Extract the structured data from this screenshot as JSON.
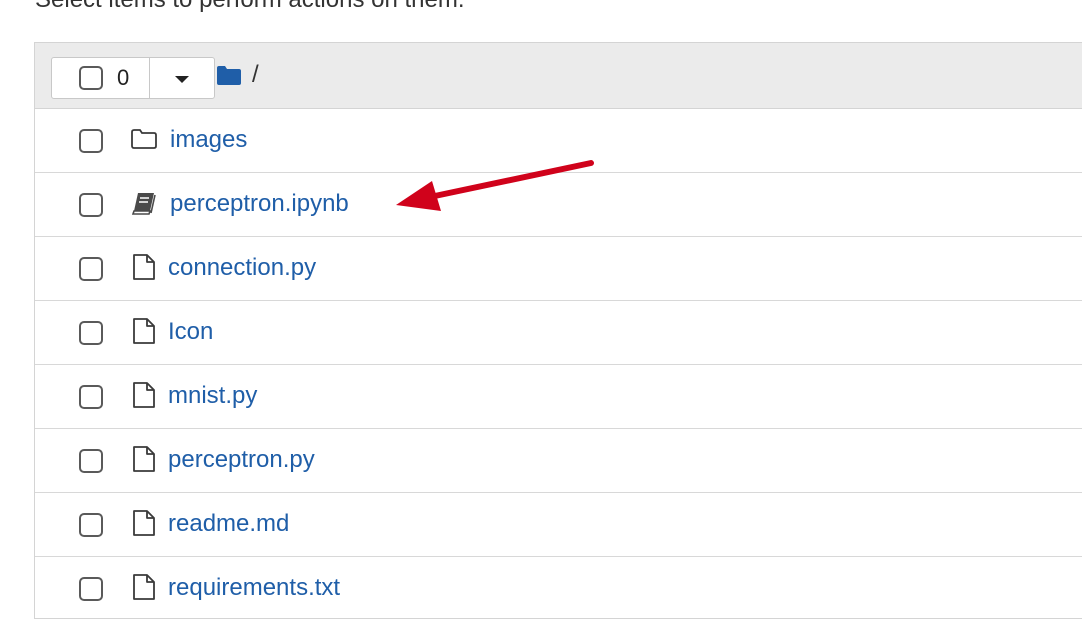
{
  "instruction": "Select items to perform actions on them.",
  "toolbar": {
    "selected_count": "0",
    "breadcrumb": "/"
  },
  "files": [
    {
      "name": "images",
      "type": "folder",
      "icon": "folder-icon"
    },
    {
      "name": "perceptron.ipynb",
      "type": "notebook",
      "icon": "notebook-icon"
    },
    {
      "name": "connection.py",
      "type": "file",
      "icon": "file-icon"
    },
    {
      "name": "Icon",
      "type": "file",
      "icon": "file-icon"
    },
    {
      "name": "mnist.py",
      "type": "file",
      "icon": "file-icon"
    },
    {
      "name": "perceptron.py",
      "type": "file",
      "icon": "file-icon"
    },
    {
      "name": "readme.md",
      "type": "file",
      "icon": "file-icon"
    },
    {
      "name": "requirements.txt",
      "type": "file",
      "icon": "file-icon"
    }
  ],
  "colors": {
    "link": "#1f5ea8",
    "header_bg": "#ebebeb",
    "annotation_arrow": "#d0021b"
  }
}
